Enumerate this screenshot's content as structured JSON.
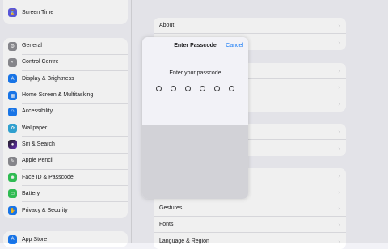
{
  "sidebar": {
    "group0": [
      {
        "label": "Screen Time",
        "icon": "hourglass-icon",
        "color": "#5e5ce6"
      }
    ],
    "group1": [
      {
        "label": "General",
        "icon": "gear-icon",
        "color": "#8e8e93"
      },
      {
        "label": "Control Centre",
        "icon": "switches-icon",
        "color": "#8e8e93"
      },
      {
        "label": "Display & Brightness",
        "icon": "aa-icon",
        "color": "#1a7cf5"
      },
      {
        "label": "Home Screen & Multitasking",
        "icon": "grid-icon",
        "color": "#1a7cf5"
      },
      {
        "label": "Accessibility",
        "icon": "accessibility-icon",
        "color": "#1a7cf5"
      },
      {
        "label": "Wallpaper",
        "icon": "flower-icon",
        "color": "#33aadc"
      },
      {
        "label": "Siri & Search",
        "icon": "siri-icon",
        "color": "#222222"
      },
      {
        "label": "Apple Pencil",
        "icon": "pencil-icon",
        "color": "#8e8e93"
      },
      {
        "label": "Face ID & Passcode",
        "icon": "faceid-icon",
        "color": "#34c759"
      },
      {
        "label": "Battery",
        "icon": "battery-icon",
        "color": "#34c759"
      },
      {
        "label": "Privacy & Security",
        "icon": "hand-icon",
        "color": "#1a7cf5"
      }
    ],
    "group2": [
      {
        "label": "App Store",
        "icon": "appstore-icon",
        "color": "#1a7cf5"
      }
    ]
  },
  "detail": {
    "groups": [
      [
        "About",
        ""
      ],
      [
        "",
        "",
        ""
      ],
      [
        "",
        ""
      ],
      [
        "",
        "",
        "Gestures",
        "Fonts",
        "Language & Region"
      ]
    ]
  },
  "passcode": {
    "title": "Enter Passcode",
    "cancel": "Cancel",
    "prompt": "Enter your passcode",
    "digits": 6
  }
}
